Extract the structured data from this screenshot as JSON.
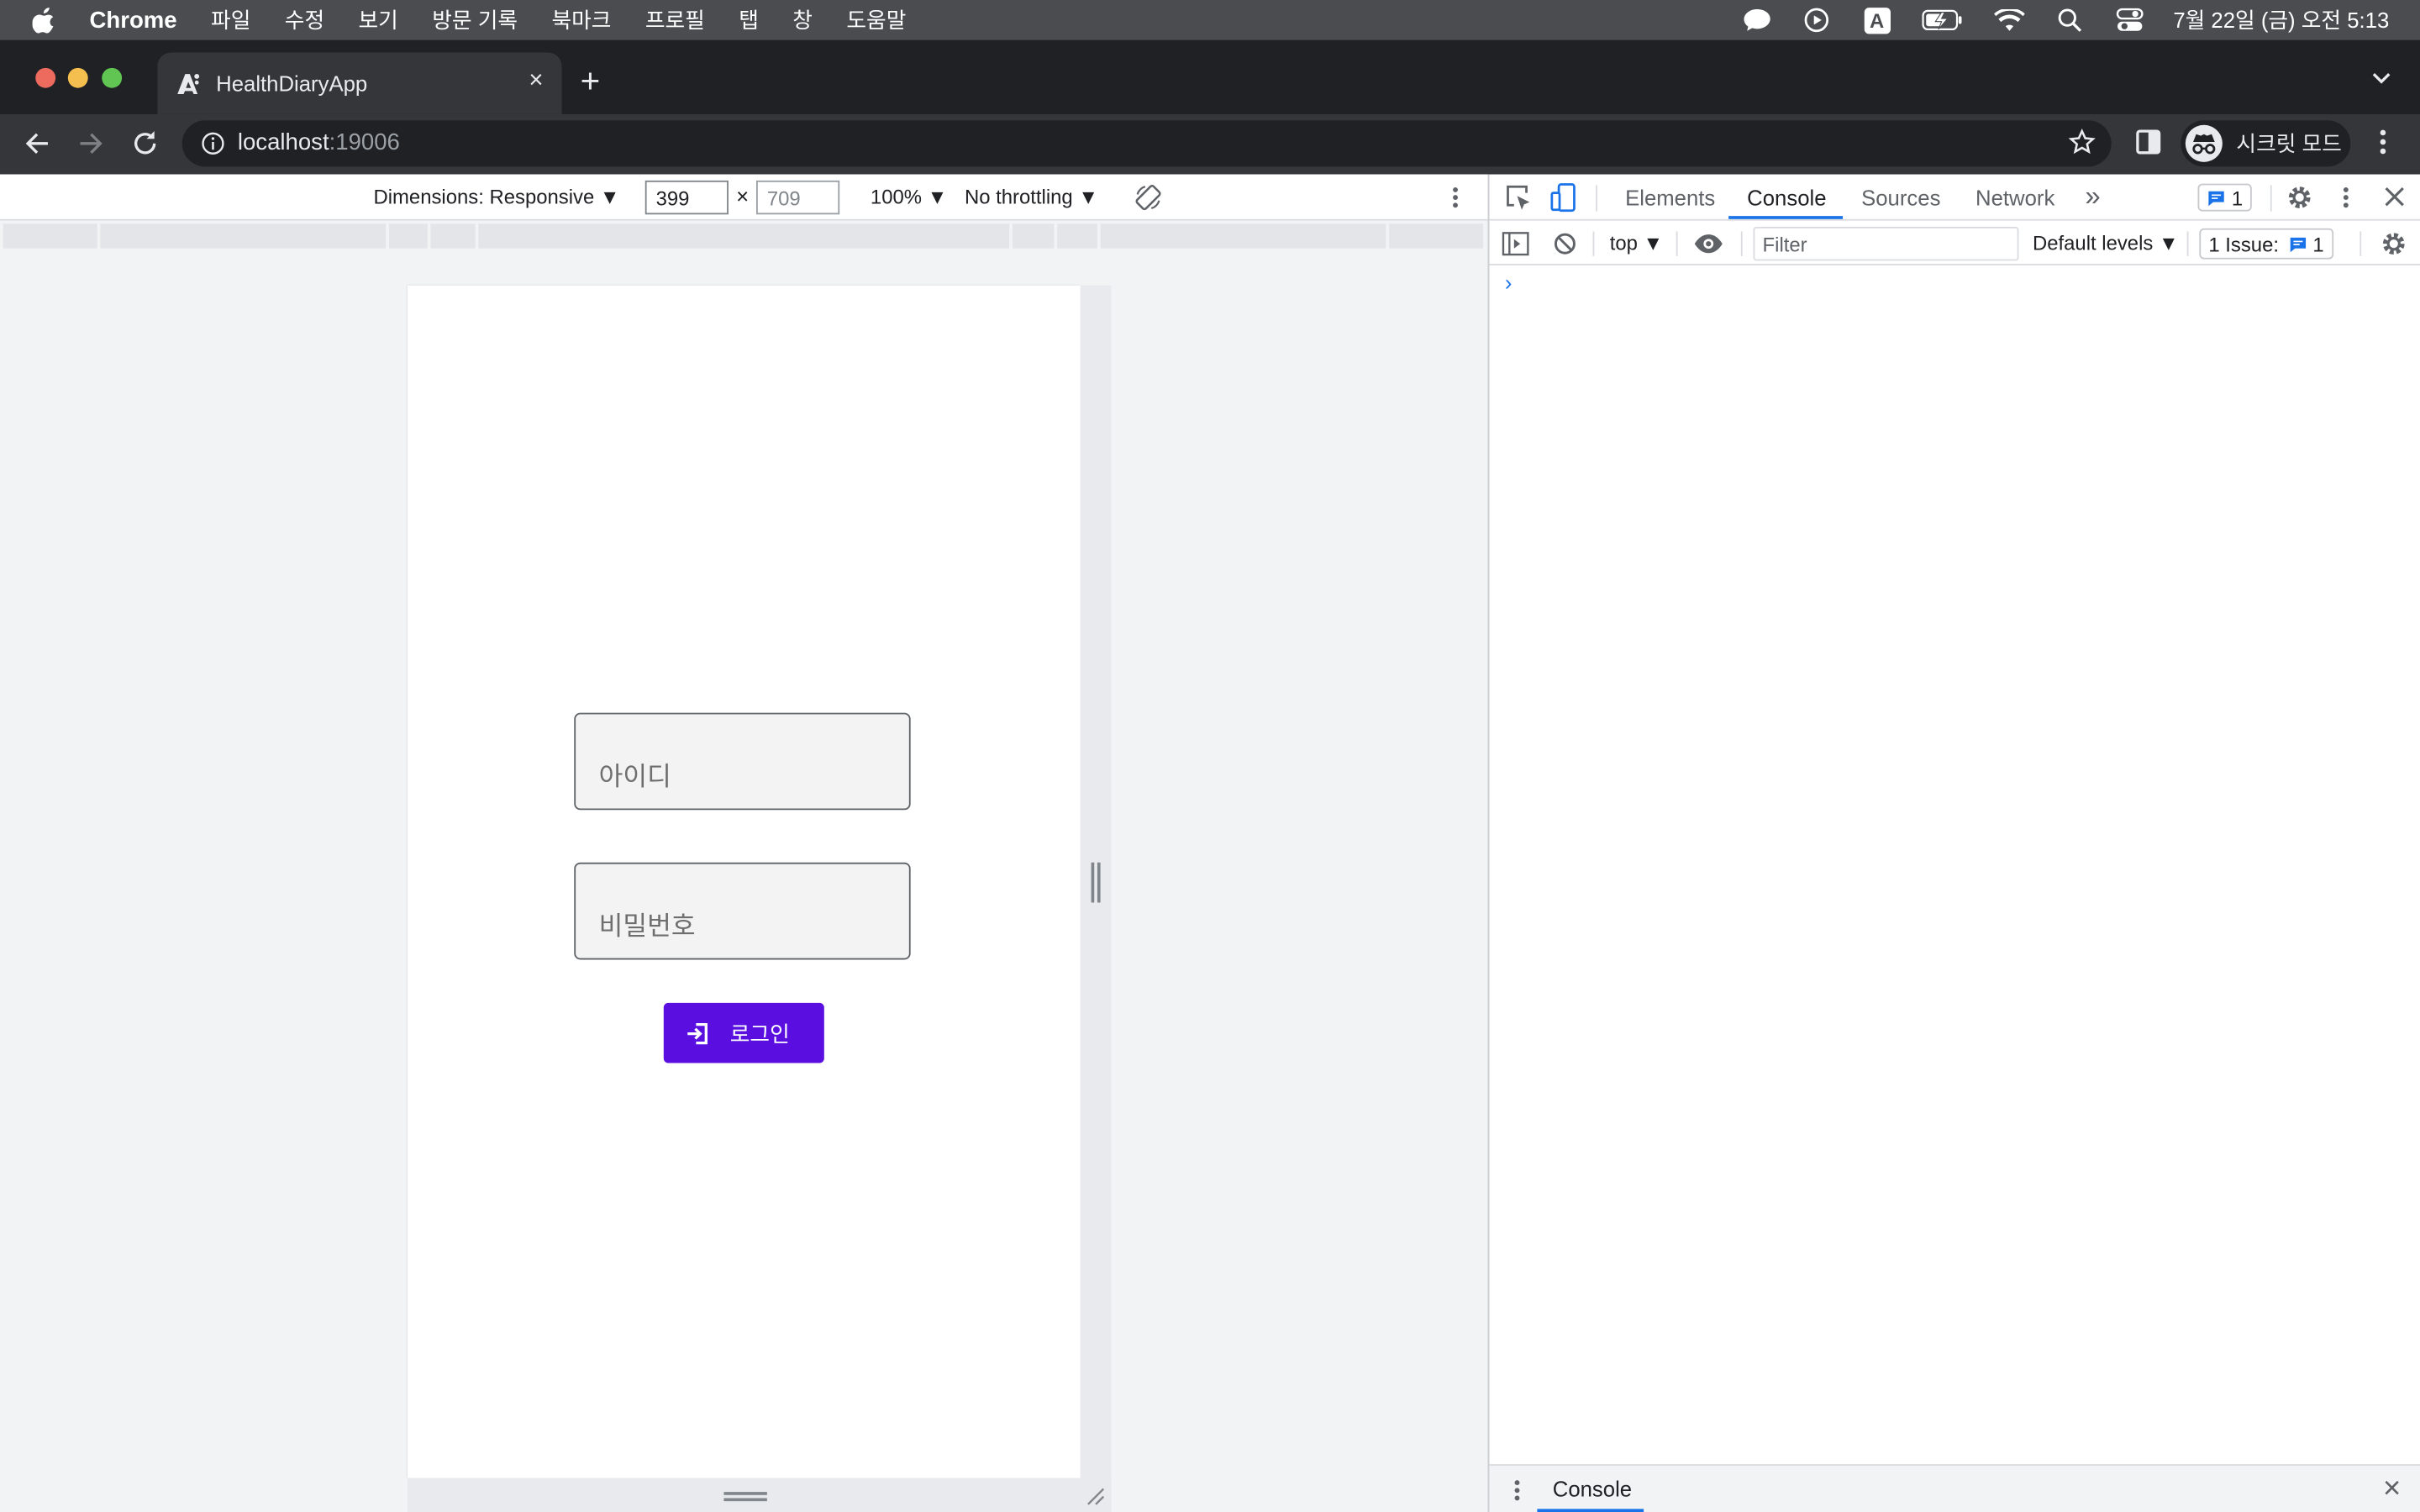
{
  "menubar": {
    "app_name": "Chrome",
    "items": [
      "파일",
      "수정",
      "보기",
      "방문 기록",
      "북마크",
      "프로필",
      "탭",
      "창",
      "도움말"
    ],
    "ime_letter": "A",
    "clock": "7월 22일 (금) 오전 5:13"
  },
  "browser": {
    "tab_title": "HealthDiaryApp",
    "tab_close": "×",
    "new_tab": "+",
    "url_host": "localhost",
    "url_port": ":19006",
    "profile_label": "시크릿 모드"
  },
  "device_toolbar": {
    "dimensions_label": "Dimensions: Responsive ▼",
    "width_value": "399",
    "times": "×",
    "height_value": "709",
    "zoom_label": "100% ▼",
    "throttle_label": "No throttling ▼"
  },
  "app": {
    "id_placeholder": "아이디",
    "password_placeholder": "비밀번호",
    "login_label": "로그인",
    "accent": "#5a0fe0"
  },
  "devtools": {
    "tabs": [
      "Elements",
      "Console",
      "Sources",
      "Network"
    ],
    "more_tabs": "»",
    "active_tab": "Console",
    "messages_badge": "1",
    "context": "top ▼",
    "filter_placeholder": "Filter",
    "levels": "Default levels ▼",
    "issues_label": "1 Issue:",
    "issues_count": "1",
    "prompt": "›",
    "drawer_tab": "Console",
    "drawer_close": "×"
  }
}
